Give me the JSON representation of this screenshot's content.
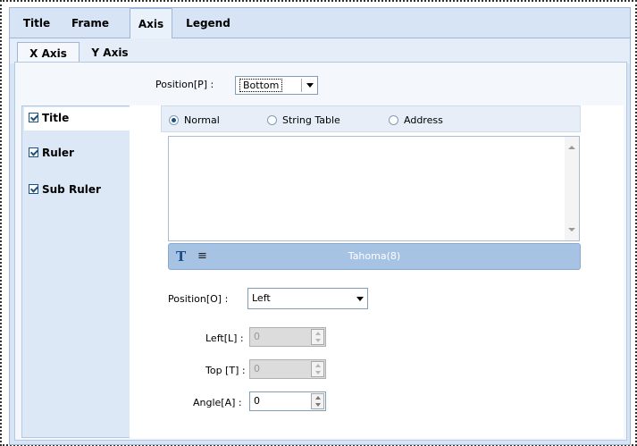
{
  "tabs": [
    "Title",
    "Frame",
    "Axis",
    "Legend"
  ],
  "active_tab": "Axis",
  "axis_tabs": [
    "X Axis",
    "Y Axis"
  ],
  "active_axis_tab": "X Axis",
  "axis_position": {
    "label": "Position[P] :",
    "value": "Bottom"
  },
  "sections": [
    {
      "label": "Title",
      "checked": true
    },
    {
      "label": "Ruler",
      "checked": true
    },
    {
      "label": "Sub Ruler",
      "checked": true
    }
  ],
  "active_section": "Title",
  "title_source": {
    "options": [
      "Normal",
      "String Table",
      "Address"
    ],
    "selected": "Normal"
  },
  "title_text": "",
  "font_bar": {
    "font": "Tahoma(8)"
  },
  "title_position": {
    "label": "Position[O] :",
    "value": "Left"
  },
  "left": {
    "label": "Left[L] :",
    "value": "0",
    "enabled": false
  },
  "top": {
    "label": "Top [T] :",
    "value": "0",
    "enabled": false
  },
  "angle": {
    "label": "Angle[A] :",
    "value": "0",
    "enabled": true
  },
  "colors": {
    "panel": "#d6e4f5",
    "accent": "#1c5180",
    "fontbar": "#a7c3e4"
  }
}
